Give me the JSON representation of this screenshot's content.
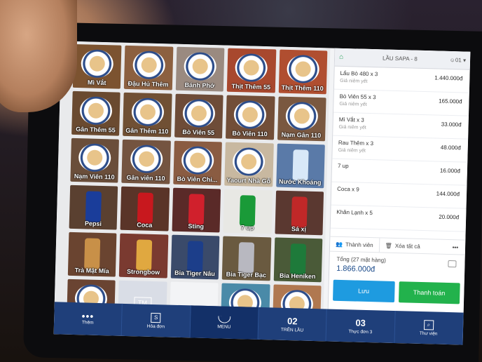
{
  "products": [
    {
      "label": "Mì Vắt",
      "kind": "plate",
      "bg": "#7c5330"
    },
    {
      "label": "Đậu Hủ Thêm",
      "kind": "plate",
      "bg": "#8c6040"
    },
    {
      "label": "Bánh Phở",
      "kind": "plate",
      "bg": "#9a8a80"
    },
    {
      "label": "Thịt Thêm 55",
      "kind": "plate",
      "bg": "#a8482e"
    },
    {
      "label": "Thịt Thêm 110",
      "kind": "plate",
      "bg": "#b04e30"
    },
    {
      "label": "Gân Thêm 55",
      "kind": "plate",
      "bg": "#6a4a30"
    },
    {
      "label": "Gân Thêm 110",
      "kind": "plate",
      "bg": "#705034"
    },
    {
      "label": "Bò Viên 55",
      "kind": "plate",
      "bg": "#6e4c38"
    },
    {
      "label": "Bò Viên 110",
      "kind": "plate",
      "bg": "#724e38"
    },
    {
      "label": "Nạm Gân 110",
      "kind": "plate",
      "bg": "#7a5840"
    },
    {
      "label": "Nạm Viên 110",
      "kind": "plate",
      "bg": "#6a4e3a"
    },
    {
      "label": "Gân viên 110",
      "kind": "plate",
      "bg": "#745440"
    },
    {
      "label": "Bò Viên Chi...",
      "kind": "plate",
      "bg": "#8a5c42"
    },
    {
      "label": "Yaourt Nhà Gỗ",
      "kind": "plate",
      "bg": "#c8b8a0"
    },
    {
      "label": "Nước Khoáng",
      "kind": "can",
      "bg": "#5a7aa8",
      "can": "#d8e8f8"
    },
    {
      "label": "Pepsi",
      "kind": "can",
      "bg": "#5a4030",
      "can": "#1a3d9a"
    },
    {
      "label": "Coca",
      "kind": "can",
      "bg": "#5a3428",
      "can": "#c8181e"
    },
    {
      "label": "Sting",
      "kind": "can",
      "bg": "#5a2a28",
      "can": "#d0202c"
    },
    {
      "label": "7 up",
      "kind": "can",
      "bg": "#e8e8e4",
      "can": "#1a9a38"
    },
    {
      "label": "Sá xị",
      "kind": "can",
      "bg": "#5a3830",
      "can": "#c02828"
    },
    {
      "label": "Trà Mật Mía",
      "kind": "can",
      "bg": "#6a4430",
      "can": "#c89048"
    },
    {
      "label": "Strongbow",
      "kind": "can",
      "bg": "#7a3a30",
      "can": "#e0a840"
    },
    {
      "label": "Bia Tiger Nâu",
      "kind": "can",
      "bg": "#3a4a6a",
      "can": "#1c3e8a"
    },
    {
      "label": "Bia Tiger Bạc",
      "kind": "can",
      "bg": "#6a5a40",
      "can": "#b8b8c0"
    },
    {
      "label": "Bia Heniken",
      "kind": "can",
      "bg": "#4a5a38",
      "can": "#1e7a3a"
    },
    {
      "label": "",
      "kind": "plate",
      "bg": "#6a4432"
    },
    {
      "label": "",
      "kind": "blank",
      "bg": "#d9dde6",
      "badge": "TM"
    },
    {
      "label": "",
      "kind": "empty",
      "bg": "#f3f4f6"
    },
    {
      "label": "",
      "kind": "plate",
      "bg": "#4a8aa8"
    },
    {
      "label": "",
      "kind": "plate",
      "bg": "#b07850"
    }
  ],
  "order": {
    "table": "LẦU SAPA - 8",
    "guests": "01",
    "items": [
      {
        "name": "Lẩu Bò 480 x 3",
        "note": "Giá niêm yết",
        "amount": "1.440.000đ"
      },
      {
        "name": "Bò Viên 55 x 3",
        "note": "Giá niêm yết",
        "amount": "165.000đ"
      },
      {
        "name": "Mì Vắt x 3",
        "note": "Giá niêm yết",
        "amount": "33.000đ"
      },
      {
        "name": "Rau Thêm x 3",
        "note": "Giá niêm yết",
        "amount": "48.000đ"
      },
      {
        "name": "7 up",
        "note": "",
        "amount": "16.000đ"
      },
      {
        "name": "Coca x 9",
        "note": "",
        "amount": "144.000đ"
      },
      {
        "name": "Khăn Lạnh x 5",
        "note": "",
        "amount": "20.000đ"
      }
    ],
    "member_label": "Thành viên",
    "clear_label": "Xóa tất cả",
    "more_label": "•••",
    "total_label": "Tổng (27 mặt hàng)",
    "total_value": "1.866.000đ",
    "save_label": "Lưu",
    "pay_label": "Thanh toán"
  },
  "nav": [
    {
      "kind": "dots",
      "label": "Thêm"
    },
    {
      "kind": "square",
      "label": "Hóa đơn",
      "glyph": "S"
    },
    {
      "kind": "bowl",
      "label": "MENU"
    },
    {
      "kind": "number",
      "big": "02",
      "label": "TRÊN LẦU"
    },
    {
      "kind": "number",
      "big": "03",
      "label": "Thực đơn 3"
    },
    {
      "kind": "square",
      "label": "Thư viện",
      "glyph": "⌕"
    }
  ],
  "colors": {
    "accent": "#1f3f7a",
    "save": "#1e9be0",
    "pay": "#22b24c"
  }
}
